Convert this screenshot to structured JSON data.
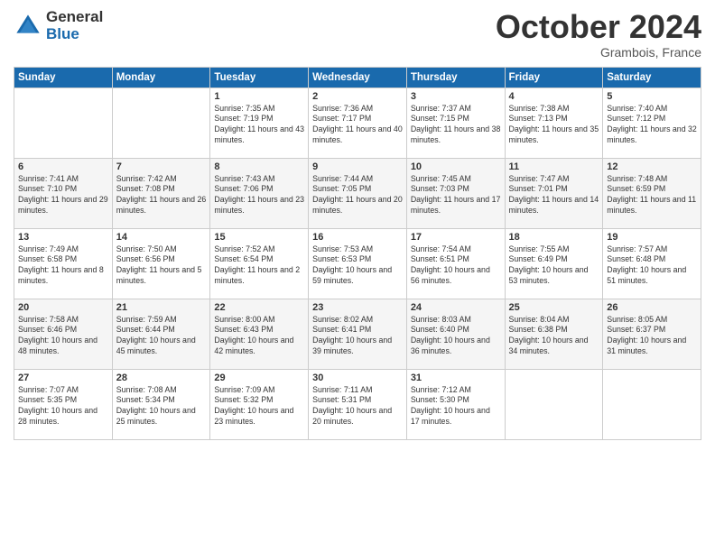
{
  "logo": {
    "general": "General",
    "blue": "Blue"
  },
  "header": {
    "month": "October 2024",
    "location": "Grambois, France"
  },
  "days_of_week": [
    "Sunday",
    "Monday",
    "Tuesday",
    "Wednesday",
    "Thursday",
    "Friday",
    "Saturday"
  ],
  "weeks": [
    [
      {
        "day": "",
        "sunrise": "",
        "sunset": "",
        "daylight": ""
      },
      {
        "day": "",
        "sunrise": "",
        "sunset": "",
        "daylight": ""
      },
      {
        "day": "1",
        "sunrise": "Sunrise: 7:35 AM",
        "sunset": "Sunset: 7:19 PM",
        "daylight": "Daylight: 11 hours and 43 minutes."
      },
      {
        "day": "2",
        "sunrise": "Sunrise: 7:36 AM",
        "sunset": "Sunset: 7:17 PM",
        "daylight": "Daylight: 11 hours and 40 minutes."
      },
      {
        "day": "3",
        "sunrise": "Sunrise: 7:37 AM",
        "sunset": "Sunset: 7:15 PM",
        "daylight": "Daylight: 11 hours and 38 minutes."
      },
      {
        "day": "4",
        "sunrise": "Sunrise: 7:38 AM",
        "sunset": "Sunset: 7:13 PM",
        "daylight": "Daylight: 11 hours and 35 minutes."
      },
      {
        "day": "5",
        "sunrise": "Sunrise: 7:40 AM",
        "sunset": "Sunset: 7:12 PM",
        "daylight": "Daylight: 11 hours and 32 minutes."
      }
    ],
    [
      {
        "day": "6",
        "sunrise": "Sunrise: 7:41 AM",
        "sunset": "Sunset: 7:10 PM",
        "daylight": "Daylight: 11 hours and 29 minutes."
      },
      {
        "day": "7",
        "sunrise": "Sunrise: 7:42 AM",
        "sunset": "Sunset: 7:08 PM",
        "daylight": "Daylight: 11 hours and 26 minutes."
      },
      {
        "day": "8",
        "sunrise": "Sunrise: 7:43 AM",
        "sunset": "Sunset: 7:06 PM",
        "daylight": "Daylight: 11 hours and 23 minutes."
      },
      {
        "day": "9",
        "sunrise": "Sunrise: 7:44 AM",
        "sunset": "Sunset: 7:05 PM",
        "daylight": "Daylight: 11 hours and 20 minutes."
      },
      {
        "day": "10",
        "sunrise": "Sunrise: 7:45 AM",
        "sunset": "Sunset: 7:03 PM",
        "daylight": "Daylight: 11 hours and 17 minutes."
      },
      {
        "day": "11",
        "sunrise": "Sunrise: 7:47 AM",
        "sunset": "Sunset: 7:01 PM",
        "daylight": "Daylight: 11 hours and 14 minutes."
      },
      {
        "day": "12",
        "sunrise": "Sunrise: 7:48 AM",
        "sunset": "Sunset: 6:59 PM",
        "daylight": "Daylight: 11 hours and 11 minutes."
      }
    ],
    [
      {
        "day": "13",
        "sunrise": "Sunrise: 7:49 AM",
        "sunset": "Sunset: 6:58 PM",
        "daylight": "Daylight: 11 hours and 8 minutes."
      },
      {
        "day": "14",
        "sunrise": "Sunrise: 7:50 AM",
        "sunset": "Sunset: 6:56 PM",
        "daylight": "Daylight: 11 hours and 5 minutes."
      },
      {
        "day": "15",
        "sunrise": "Sunrise: 7:52 AM",
        "sunset": "Sunset: 6:54 PM",
        "daylight": "Daylight: 11 hours and 2 minutes."
      },
      {
        "day": "16",
        "sunrise": "Sunrise: 7:53 AM",
        "sunset": "Sunset: 6:53 PM",
        "daylight": "Daylight: 10 hours and 59 minutes."
      },
      {
        "day": "17",
        "sunrise": "Sunrise: 7:54 AM",
        "sunset": "Sunset: 6:51 PM",
        "daylight": "Daylight: 10 hours and 56 minutes."
      },
      {
        "day": "18",
        "sunrise": "Sunrise: 7:55 AM",
        "sunset": "Sunset: 6:49 PM",
        "daylight": "Daylight: 10 hours and 53 minutes."
      },
      {
        "day": "19",
        "sunrise": "Sunrise: 7:57 AM",
        "sunset": "Sunset: 6:48 PM",
        "daylight": "Daylight: 10 hours and 51 minutes."
      }
    ],
    [
      {
        "day": "20",
        "sunrise": "Sunrise: 7:58 AM",
        "sunset": "Sunset: 6:46 PM",
        "daylight": "Daylight: 10 hours and 48 minutes."
      },
      {
        "day": "21",
        "sunrise": "Sunrise: 7:59 AM",
        "sunset": "Sunset: 6:44 PM",
        "daylight": "Daylight: 10 hours and 45 minutes."
      },
      {
        "day": "22",
        "sunrise": "Sunrise: 8:00 AM",
        "sunset": "Sunset: 6:43 PM",
        "daylight": "Daylight: 10 hours and 42 minutes."
      },
      {
        "day": "23",
        "sunrise": "Sunrise: 8:02 AM",
        "sunset": "Sunset: 6:41 PM",
        "daylight": "Daylight: 10 hours and 39 minutes."
      },
      {
        "day": "24",
        "sunrise": "Sunrise: 8:03 AM",
        "sunset": "Sunset: 6:40 PM",
        "daylight": "Daylight: 10 hours and 36 minutes."
      },
      {
        "day": "25",
        "sunrise": "Sunrise: 8:04 AM",
        "sunset": "Sunset: 6:38 PM",
        "daylight": "Daylight: 10 hours and 34 minutes."
      },
      {
        "day": "26",
        "sunrise": "Sunrise: 8:05 AM",
        "sunset": "Sunset: 6:37 PM",
        "daylight": "Daylight: 10 hours and 31 minutes."
      }
    ],
    [
      {
        "day": "27",
        "sunrise": "Sunrise: 7:07 AM",
        "sunset": "Sunset: 5:35 PM",
        "daylight": "Daylight: 10 hours and 28 minutes."
      },
      {
        "day": "28",
        "sunrise": "Sunrise: 7:08 AM",
        "sunset": "Sunset: 5:34 PM",
        "daylight": "Daylight: 10 hours and 25 minutes."
      },
      {
        "day": "29",
        "sunrise": "Sunrise: 7:09 AM",
        "sunset": "Sunset: 5:32 PM",
        "daylight": "Daylight: 10 hours and 23 minutes."
      },
      {
        "day": "30",
        "sunrise": "Sunrise: 7:11 AM",
        "sunset": "Sunset: 5:31 PM",
        "daylight": "Daylight: 10 hours and 20 minutes."
      },
      {
        "day": "31",
        "sunrise": "Sunrise: 7:12 AM",
        "sunset": "Sunset: 5:30 PM",
        "daylight": "Daylight: 10 hours and 17 minutes."
      },
      {
        "day": "",
        "sunrise": "",
        "sunset": "",
        "daylight": ""
      },
      {
        "day": "",
        "sunrise": "",
        "sunset": "",
        "daylight": ""
      }
    ]
  ]
}
